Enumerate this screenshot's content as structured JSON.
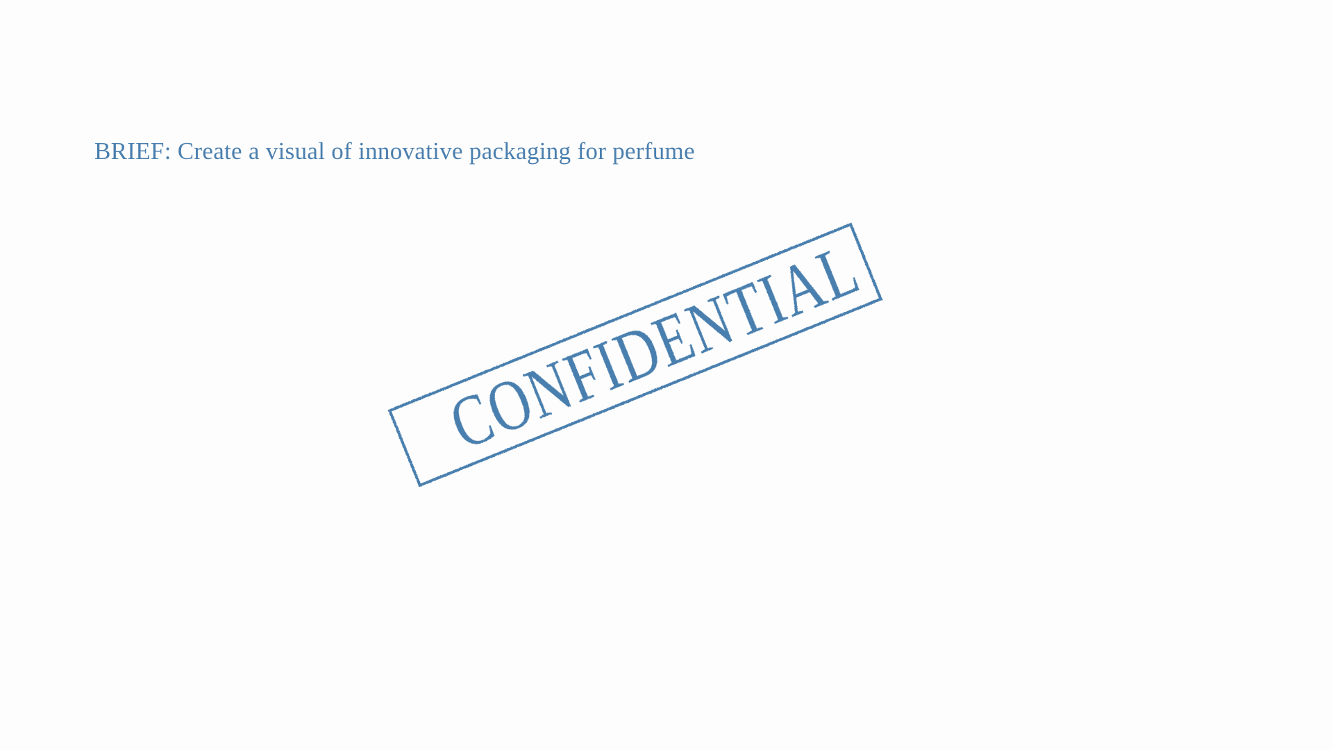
{
  "brief": {
    "text": "BRIEF: Create a visual of innovative packaging for perfume"
  },
  "stamp": {
    "text": "CONFIDENTIAL"
  },
  "colors": {
    "ink": "#4a7fae",
    "background": "#fdfdfd"
  }
}
